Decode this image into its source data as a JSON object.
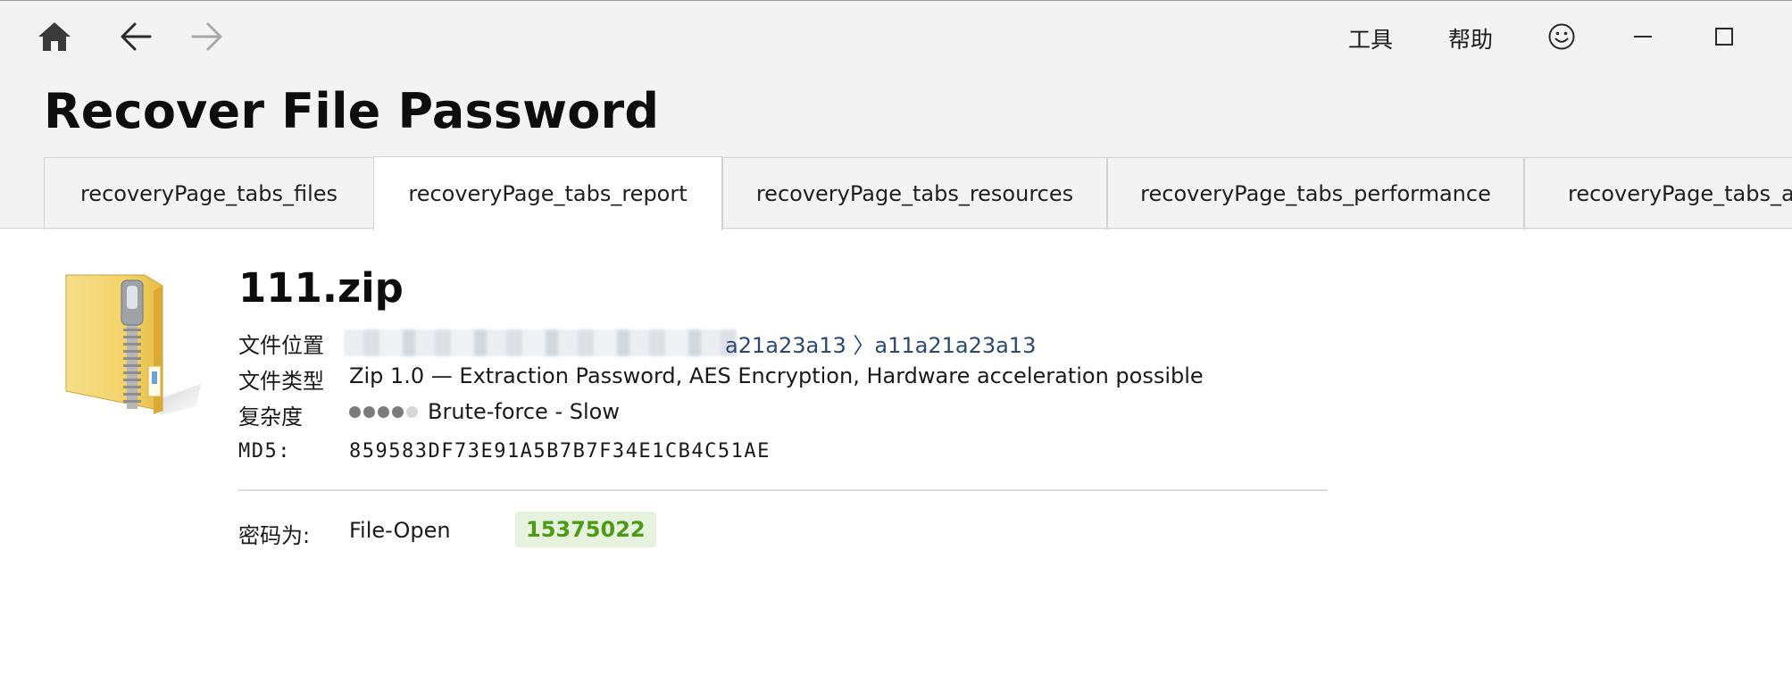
{
  "nav": {
    "home_icon": "home-icon",
    "back_icon": "arrow-left-icon",
    "forward_icon": "arrow-right-icon"
  },
  "menu": {
    "tools": "工具",
    "help": "帮助"
  },
  "window": {
    "feedback_icon": "smiley-icon",
    "minimize_icon": "minimize-icon",
    "maximize_icon": "maximize-icon"
  },
  "page": {
    "title": "Recover File Password"
  },
  "tabs": [
    {
      "label": "recoveryPage_tabs_files",
      "active": false
    },
    {
      "label": "recoveryPage_tabs_report",
      "active": true
    },
    {
      "label": "recoveryPage_tabs_resources",
      "active": false
    },
    {
      "label": "recoveryPage_tabs_performance",
      "active": false
    },
    {
      "label": "recoveryPage_tabs_attack",
      "active": false
    }
  ],
  "file": {
    "name": "111.zip",
    "icon": "zip-folder-icon",
    "location_label": "文件位置",
    "location_visible": "a21a23a13 〉a11a21a23a13",
    "type_label": "文件类型",
    "type_value": "Zip 1.0 — Extraction Password, AES Encryption, Hardware acceleration possible",
    "complexity_label": "复杂度",
    "complexity_level": 4,
    "complexity_max": 5,
    "complexity_value": "Brute-force - Slow",
    "md5_label": "MD5:",
    "md5_value": "859583DF73E91A5B7B7F34E1CB4C51AE"
  },
  "password": {
    "label": "密码为:",
    "type": "File-Open",
    "value": "15375022"
  },
  "colors": {
    "header_bg": "#f3f3f3",
    "link": "#2b4a72",
    "password_fg": "#4c9a16",
    "password_bg": "#e6f2dd"
  }
}
